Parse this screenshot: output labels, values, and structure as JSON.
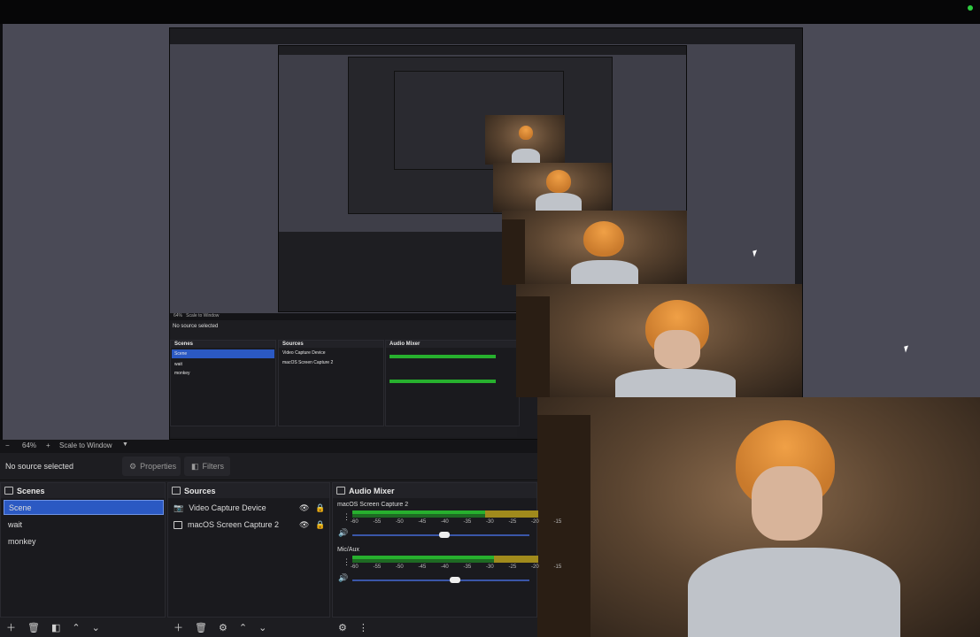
{
  "app": {
    "zoom_level": "64%",
    "zoom_minus": "−",
    "zoom_plus": "+",
    "scale_mode": "Scale to Window",
    "status": "No source selected",
    "properties_label": "Properties",
    "filters_label": "Filters"
  },
  "scenes": {
    "title": "Scenes",
    "items": [
      {
        "label": "Scene",
        "selected": true
      },
      {
        "label": "wait",
        "selected": false
      },
      {
        "label": "monkey",
        "selected": false
      }
    ]
  },
  "sources": {
    "title": "Sources",
    "items": [
      {
        "label": "Video Capture Device",
        "icon": "camera-icon"
      },
      {
        "label": "macOS Screen Capture 2",
        "icon": "monitor-icon"
      }
    ]
  },
  "mixer": {
    "title": "Audio Mixer",
    "channels": [
      {
        "name": "macOS Screen Capture 2",
        "volume": 0.42
      },
      {
        "name": "Mic/Aux",
        "volume": 0.48
      }
    ],
    "scale": [
      "-60",
      "-55",
      "-50",
      "-45",
      "-40",
      "-35",
      "-30",
      "-25",
      "-20",
      "-15"
    ]
  },
  "colors": {
    "accent": "#2b59c3",
    "meter_green": "#27b02e",
    "meter_yellow": "#a08a1c"
  }
}
